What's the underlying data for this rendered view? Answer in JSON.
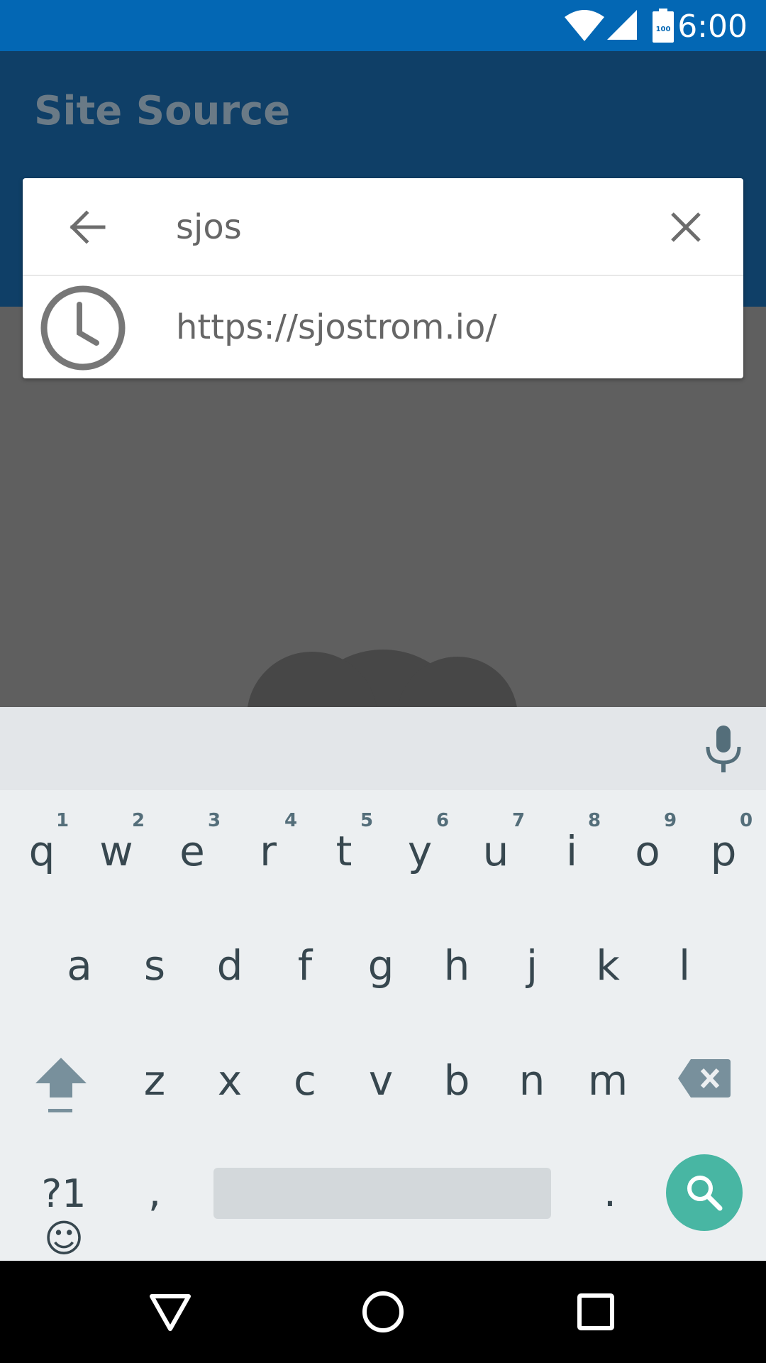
{
  "status_bar": {
    "time": "6:00",
    "battery_level": "100",
    "icons": [
      "wifi-icon",
      "signal-icon",
      "battery-icon"
    ]
  },
  "app_bar": {
    "title": "Site Source"
  },
  "search": {
    "query": "sjos",
    "placeholder": ""
  },
  "suggestions": [
    {
      "text": "https://sjostrom.io/",
      "icon": "history-icon"
    }
  ],
  "keyboard": {
    "row1": [
      "q",
      "w",
      "e",
      "r",
      "t",
      "y",
      "u",
      "i",
      "o",
      "p"
    ],
    "row1_hints": [
      "1",
      "2",
      "3",
      "4",
      "5",
      "6",
      "7",
      "8",
      "9",
      "0"
    ],
    "row2": [
      "a",
      "s",
      "d",
      "f",
      "g",
      "h",
      "j",
      "k",
      "l"
    ],
    "row3": [
      "z",
      "x",
      "c",
      "v",
      "b",
      "n",
      "m"
    ],
    "symbols_label": "?1☺",
    "comma": ",",
    "period": "."
  },
  "colors": {
    "status_bar": "#0367b4",
    "app_bar": "#0f3f67",
    "accent_search_key": "#48b6a3"
  }
}
